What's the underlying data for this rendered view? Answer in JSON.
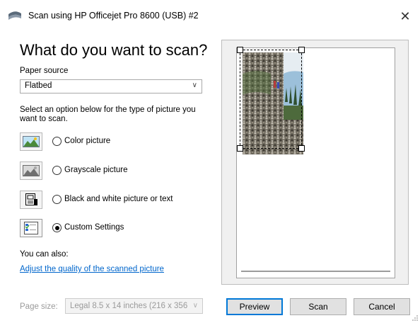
{
  "window": {
    "title": "Scan using HP Officejet Pro 8600 (USB) #2",
    "close_glyph": "✕"
  },
  "heading": "What do you want to scan?",
  "paper_source": {
    "label": "Paper source",
    "value": "Flatbed"
  },
  "description": "Select an option below for the type of picture you want to scan.",
  "options": [
    {
      "label": "Color picture",
      "selected": false,
      "icon": "color-picture-icon"
    },
    {
      "label": "Grayscale picture",
      "selected": false,
      "icon": "grayscale-picture-icon"
    },
    {
      "label": "Black and white picture or text",
      "selected": false,
      "icon": "bw-picture-text-icon"
    },
    {
      "label": "Custom Settings",
      "selected": true,
      "icon": "custom-settings-icon"
    }
  ],
  "also": {
    "label": "You can also:",
    "link": "Adjust the quality of the scanned picture"
  },
  "footer": {
    "page_size_label": "Page size:",
    "page_size_value": "Legal 8.5 x 14 inches (216 x 356",
    "preview_label": "Preview",
    "scan_label": "Scan",
    "cancel_label": "Cancel"
  },
  "colors": {
    "link": "#0066cc",
    "accent": "#0078d7"
  }
}
